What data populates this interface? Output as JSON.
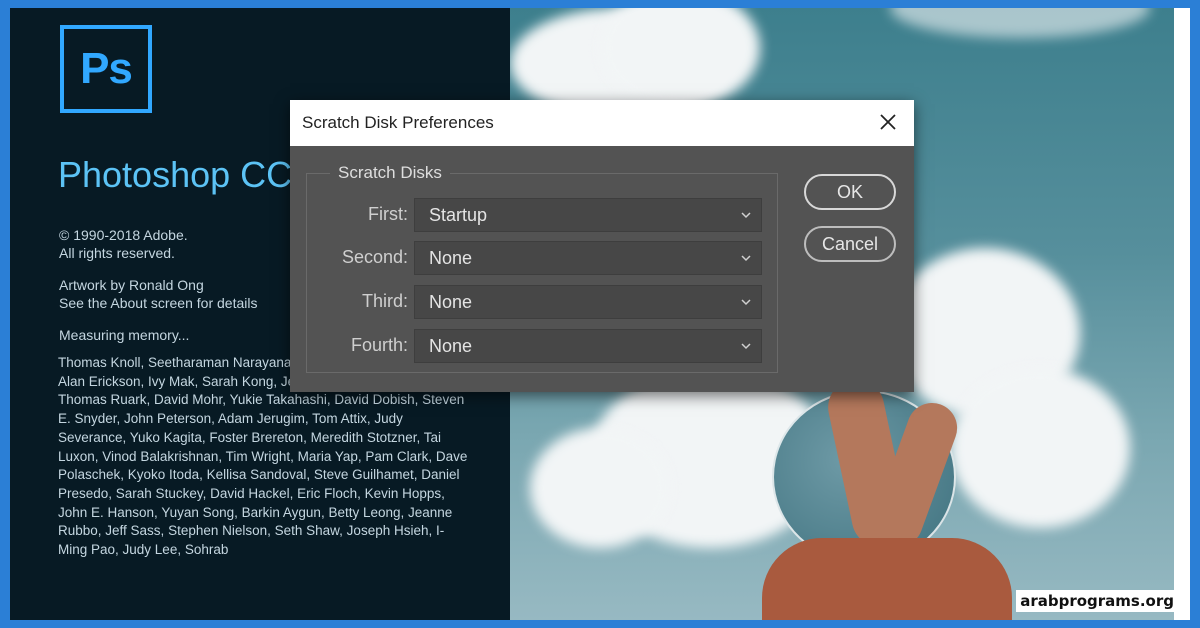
{
  "splash": {
    "logo": "Ps",
    "product": "Photoshop CC",
    "copyright": "© 1990-2018 Adobe.",
    "rights": "All rights reserved.",
    "artwork": "Artwork by Ronald Ong",
    "about": "See the About screen for details",
    "status": "Measuring memory...",
    "credits": "Thomas Knoll, Seetharaman Narayanan, Jackie Lincoln-Owyang, Alan Erickson, Ivy Mak, Sarah Kong, Jerry Harris, Mike Shaw, Thomas Ruark, David Mohr, Yukie Takahashi, David Dobish, Steven E. Snyder, John Peterson, Adam Jerugim, Tom Attix, Judy Severance, Yuko Kagita, Foster Brereton, Meredith Stotzner, Tai Luxon, Vinod Balakrishnan, Tim Wright, Maria Yap, Pam Clark, Dave Polaschek, Kyoko Itoda, Kellisa Sandoval, Steve Guilhamet, Daniel Presedo, Sarah Stuckey, David Hackel, Eric Floch, Kevin Hopps, John E. Hanson, Yuyan Song, Barkin Aygun, Betty Leong, Jeanne Rubbo, Jeff Sass, Stephen Nielson, Seth Shaw, Joseph Hsieh, I-Ming Pao, Judy Lee, Sohrab"
  },
  "dialog": {
    "title": "Scratch Disk Preferences",
    "close_icon": "close-icon",
    "group_label": "Scratch Disks",
    "rows": [
      {
        "label": "First:",
        "value": "Startup"
      },
      {
        "label": "Second:",
        "value": "None"
      },
      {
        "label": "Third:",
        "value": "None"
      },
      {
        "label": "Fourth:",
        "value": "None"
      }
    ],
    "ok_label": "OK",
    "cancel_label": "Cancel"
  },
  "watermark": "arabprograms.org",
  "colors": {
    "ps_blue": "#31a8ff",
    "dialog_bg": "#535353",
    "splash_bg": "#071a24",
    "frame_border": "#2b7fd6"
  }
}
